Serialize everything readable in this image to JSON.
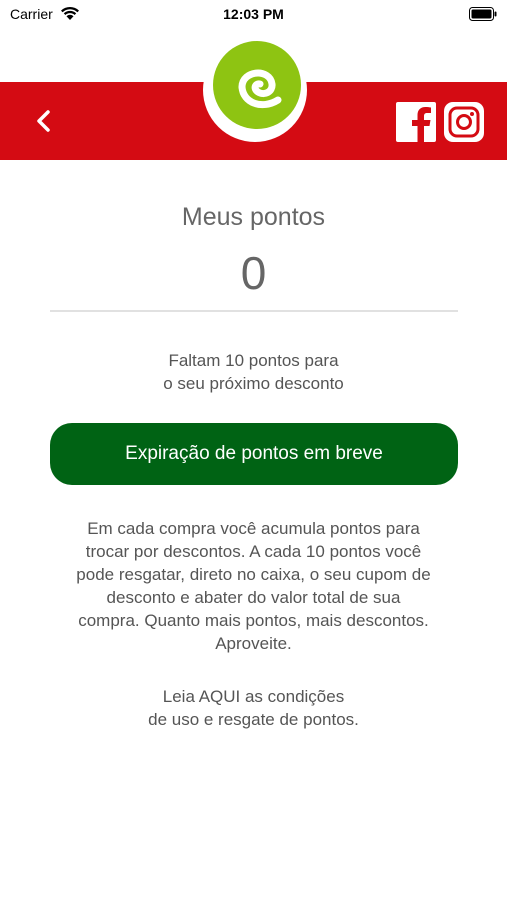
{
  "status_bar": {
    "carrier": "Carrier",
    "time": "12:03 PM"
  },
  "header": {
    "back_icon": "chevron-left-icon",
    "logo_icon": "brand-logo-icon",
    "social": [
      "facebook-icon",
      "instagram-icon"
    ]
  },
  "colors": {
    "header": "#d40b13",
    "button": "#006314",
    "logo_green": "#8ec412"
  },
  "points": {
    "title": "Meus pontos",
    "value": "0",
    "remaining_line1": "Faltam 10 pontos para",
    "remaining_line2": "o seu próximo desconto"
  },
  "expire_button": {
    "label": "Expiração de pontos em breve"
  },
  "info": {
    "line1": "Em cada compra você acumula pontos para",
    "line2": "trocar por descontos. A cada 10 pontos você",
    "line3": "pode resgatar, direto no caixa, o seu cupom de",
    "line4": "desconto e abater do valor total de sua",
    "line5": "compra. Quanto mais pontos, mais descontos.",
    "line6": "Aproveite."
  },
  "terms": {
    "line1": "Leia AQUI as condições",
    "line2": "de uso e resgate de pontos."
  }
}
